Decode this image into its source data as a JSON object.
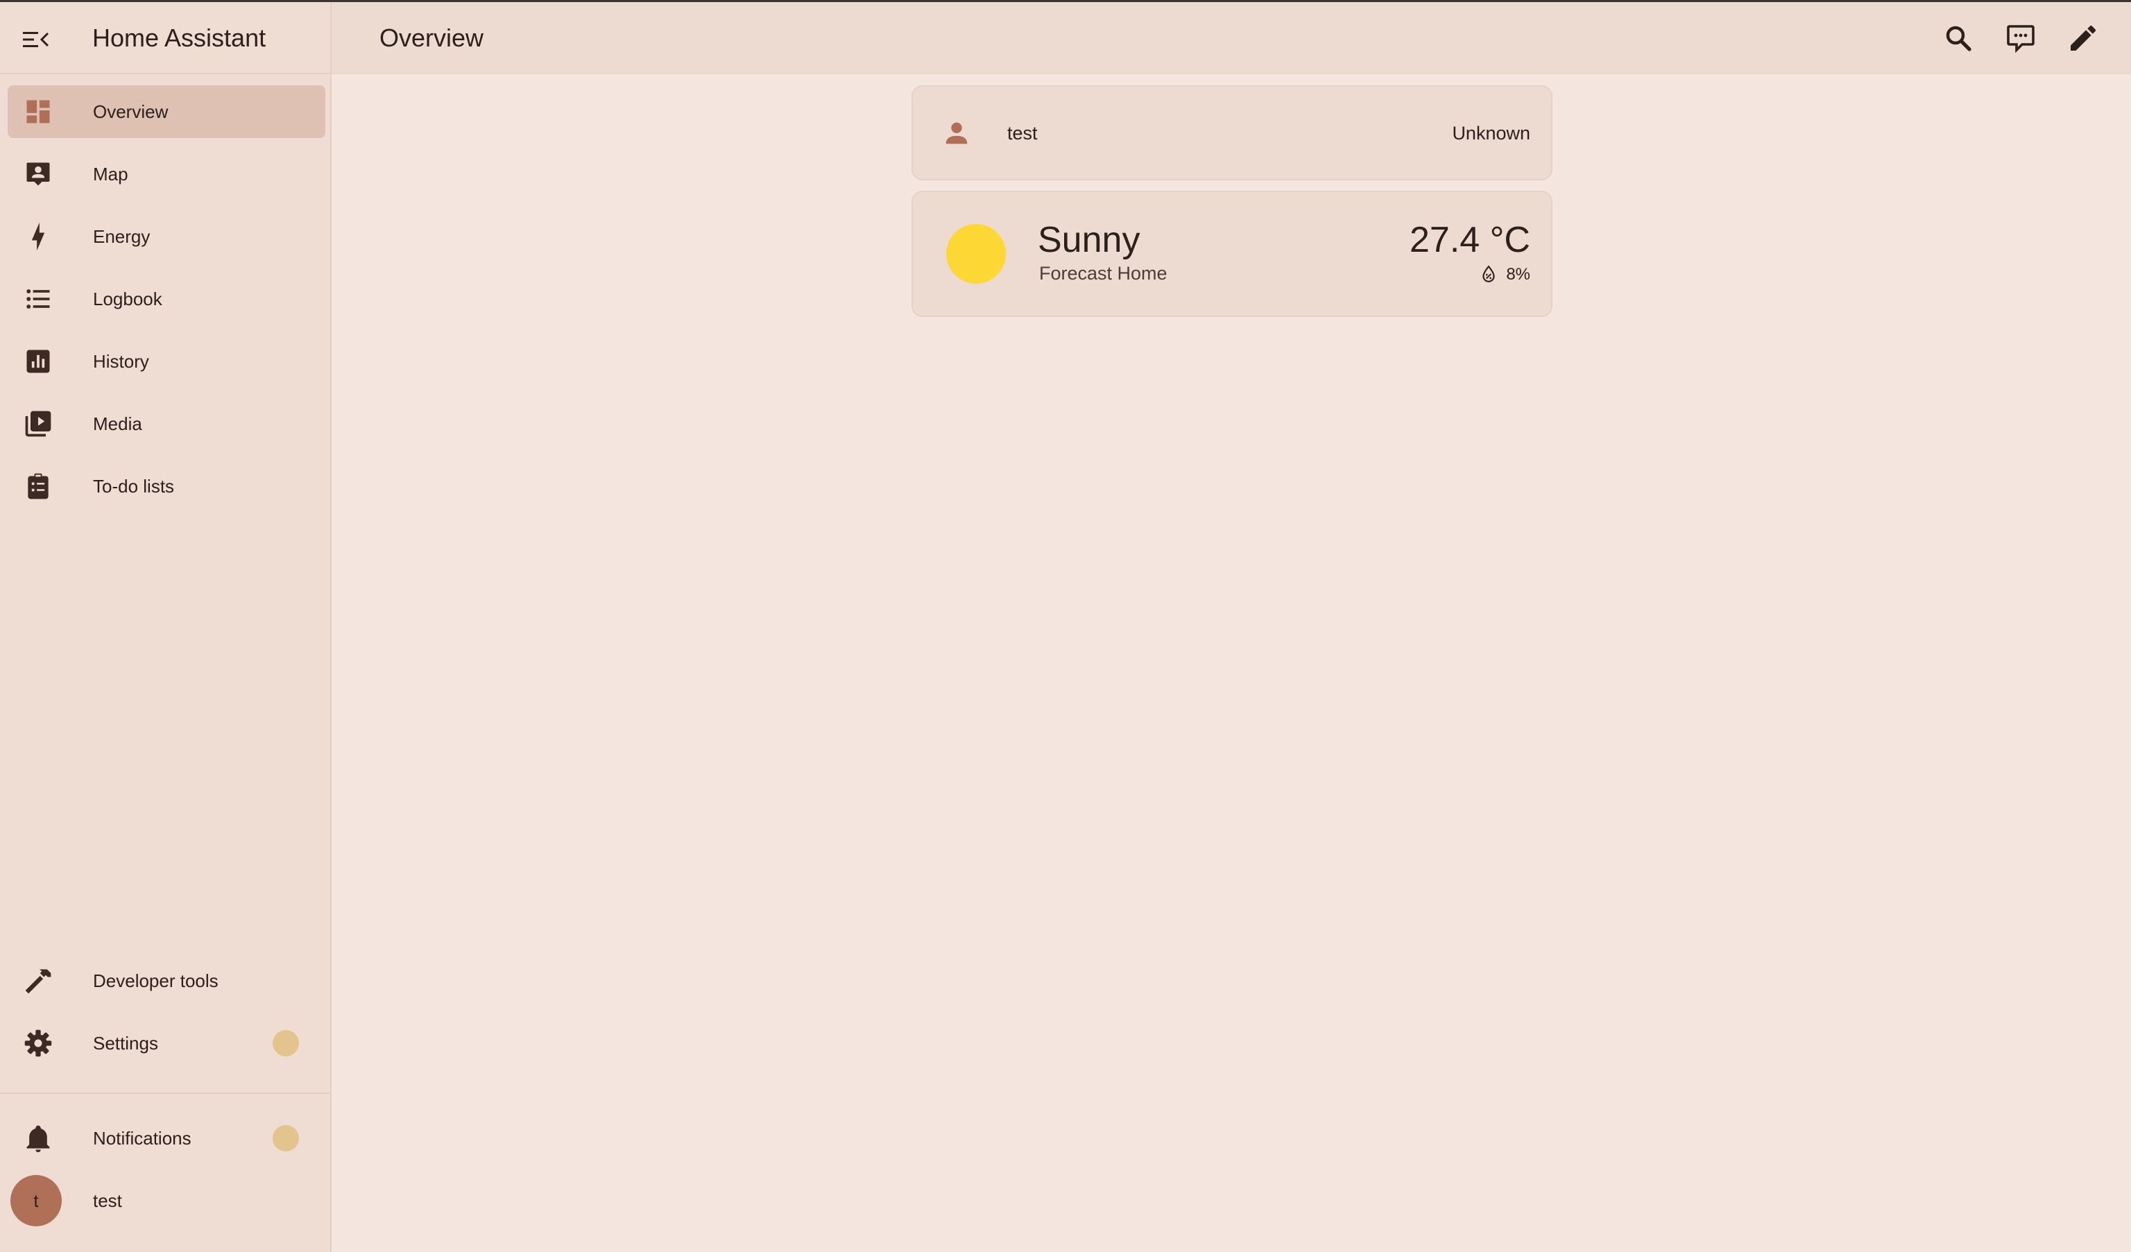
{
  "app": {
    "title": "Home Assistant"
  },
  "header": {
    "title": "Overview"
  },
  "sidebar": {
    "items": [
      {
        "label": "Overview",
        "icon": "dashboard-icon",
        "active": true
      },
      {
        "label": "Map",
        "icon": "map-account-icon"
      },
      {
        "label": "Energy",
        "icon": "lightning-bolt-icon"
      },
      {
        "label": "Logbook",
        "icon": "format-list-bulleted-icon"
      },
      {
        "label": "History",
        "icon": "chart-box-icon"
      },
      {
        "label": "Media",
        "icon": "play-box-multiple-icon"
      },
      {
        "label": "To-do lists",
        "icon": "clipboard-list-icon"
      }
    ],
    "bottom_items": [
      {
        "label": "Developer tools",
        "icon": "hammer-icon"
      },
      {
        "label": "Settings",
        "icon": "cog-icon"
      }
    ],
    "notifications": {
      "label": "Notifications",
      "icon": "bell-icon"
    },
    "user": {
      "label": "test",
      "initial": "t"
    }
  },
  "cards": {
    "entity": {
      "name": "test",
      "state": "Unknown",
      "icon": "account-icon"
    },
    "weather": {
      "condition": "Sunny",
      "name": "Forecast Home",
      "temperature": "27.4 °C",
      "precipitation": "8%",
      "condition_icon": "sun-icon",
      "precipitation_icon": "water-percent-icon"
    }
  },
  "colors": {
    "sidebar_bg": "#efdcd3",
    "page_bg": "#f4e5df",
    "active_item_bg": "#dfc1b4",
    "icon_brown": "#b07058",
    "badge": "#e3c48c",
    "sun": "#fdd835"
  }
}
